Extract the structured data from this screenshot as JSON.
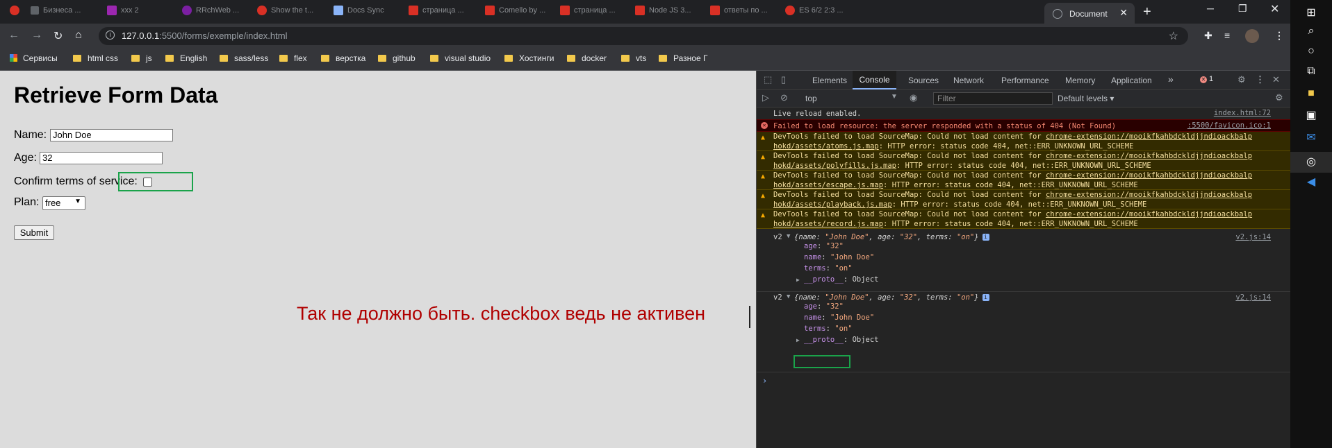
{
  "browser": {
    "tabs": [
      {
        "title": "Бизнеса ...",
        "color": "#d93025"
      },
      {
        "title": "ххх 2",
        "color": "#d93025"
      },
      {
        "title": "RRchWeb ...",
        "color": "#7b1fa2"
      },
      {
        "title": "Show the t...",
        "color": "#d93025"
      },
      {
        "title": "Docs Sync",
        "color": "#5f6368"
      },
      {
        "title": "страница ...",
        "color": "#d93025"
      },
      {
        "title": "Comello by ...",
        "color": "#d93025"
      },
      {
        "title": "страница ...",
        "color": "#d93025"
      },
      {
        "title": "Node JS 3...",
        "color": "#d93025"
      },
      {
        "title": "ответы по ...",
        "color": "#d93025"
      },
      {
        "title": "ES 6/2 2:3 ...",
        "color": "#d93025"
      }
    ],
    "active_tab": {
      "title": "Document"
    },
    "newtab_symbol": "+",
    "window_controls": {
      "minimize": "─",
      "maximize": "❐",
      "close": "✕"
    },
    "url": {
      "host": "127.0.0.1",
      "path": ":5500/forms/exemple/index.html"
    },
    "bookmarks": [
      "Сервисы",
      "html css",
      "js",
      "English",
      "sass/less",
      "flex",
      "верстка",
      "github",
      "visual studio",
      "Хостинги",
      "docker",
      "vts",
      "Разное Г"
    ]
  },
  "page": {
    "title": "Retrieve Form Data",
    "name_label": "Name:",
    "name_value": "John Doe",
    "age_label": "Age:",
    "age_value": "32",
    "terms_label": "Confirm terms of service:",
    "terms_checked": false,
    "plan_label": "Plan:",
    "plan_value": "free",
    "submit_label": "Submit",
    "annotation": "Так не должно быть. checkbox ведь не активен"
  },
  "devtools": {
    "tabs": [
      "Elements",
      "Console",
      "Sources",
      "Network",
      "Performance",
      "Memory",
      "Application"
    ],
    "more_tabs": "»",
    "error_count": "1",
    "context": "top",
    "filter_placeholder": "Filter",
    "levels": "Default levels",
    "messages": [
      {
        "type": "log",
        "text": "Live reload enabled.",
        "source": "index.html:72"
      },
      {
        "type": "error",
        "text": "Failed to load resource: the server responded with a status of 404 (Not Found)",
        "source": ":5500/favicon.ico:1"
      },
      {
        "type": "warning",
        "line1_prefix": "DevTools failed to load SourceMap: Could not load content for ",
        "line1_link": "chrome-extension://mooikfkahbdckldjjndioackbalp",
        "line2_link": "hokd/assets/atoms.js.map",
        "line2_suffix": ": HTTP error: status code 404, net::ERR_UNKNOWN_URL_SCHEME"
      },
      {
        "type": "warning",
        "line1_prefix": "DevTools failed to load SourceMap: Could not load content for ",
        "line1_link": "chrome-extension://mooikfkahbdckldjjndioackbalp",
        "line2_link": "hokd/assets/polyfills.js.map",
        "line2_suffix": ": HTTP error: status code 404, net::ERR_UNKNOWN_URL_SCHEME"
      },
      {
        "type": "warning",
        "line1_prefix": "DevTools failed to load SourceMap: Could not load content for ",
        "line1_link": "chrome-extension://mooikfkahbdckldjjndioackbalp",
        "line2_link": "hokd/assets/escape.js.map",
        "line2_suffix": ": HTTP error: status code 404, net::ERR_UNKNOWN_URL_SCHEME"
      },
      {
        "type": "warning",
        "line1_prefix": "DevTools failed to load SourceMap: Could not load content for ",
        "line1_link": "chrome-extension://mooikfkahbdckldjjndioackbalp",
        "line2_link": "hokd/assets/playback.js.map",
        "line2_suffix": ": HTTP error: status code 404, net::ERR_UNKNOWN_URL_SCHEME"
      },
      {
        "type": "warning",
        "line1_prefix": "DevTools failed to load SourceMap: Could not load content for ",
        "line1_link": "chrome-extension://mooikfkahbdckldjjndioackbalp",
        "line2_link": "hokd/assets/record.js.map",
        "line2_suffix": ": HTTP error: status code 404, net::ERR_UNKNOWN_URL_SCHEME"
      }
    ],
    "objects": [
      {
        "prefix": "v2",
        "summary_open": "{name: ",
        "s_name": "\"John Doe\"",
        "s_age_key": ", age: ",
        "s_age": "\"32\"",
        "s_terms_key": ", terms: ",
        "s_terms": "\"on\"",
        "summary_close": "}",
        "source": "v2.js:14",
        "age_key": "age",
        "age_val": "\"32\"",
        "name_key": "name",
        "name_val": "\"John Doe\"",
        "terms_key": "terms",
        "terms_val": "\"on\"",
        "proto_key": "__proto__",
        "proto_val": "Object"
      },
      {
        "prefix": "v2",
        "summary_open": "{name: ",
        "s_name": "\"John Doe\"",
        "s_age_key": ", age: ",
        "s_age": "\"32\"",
        "s_terms_key": ", terms: ",
        "s_terms": "\"on\"",
        "summary_close": "}",
        "source": "v2.js:14",
        "age_key": "age",
        "age_val": "\"32\"",
        "name_key": "name",
        "name_val": "\"John Doe\"",
        "terms_key": "terms",
        "terms_val": "\"on\"",
        "proto_key": "__proto__",
        "proto_val": "Object"
      }
    ],
    "prompt": "›"
  },
  "colors": {
    "highlight": "#1aa34a",
    "annotation": "#b00000",
    "page_bg": "#dcdcdc"
  }
}
